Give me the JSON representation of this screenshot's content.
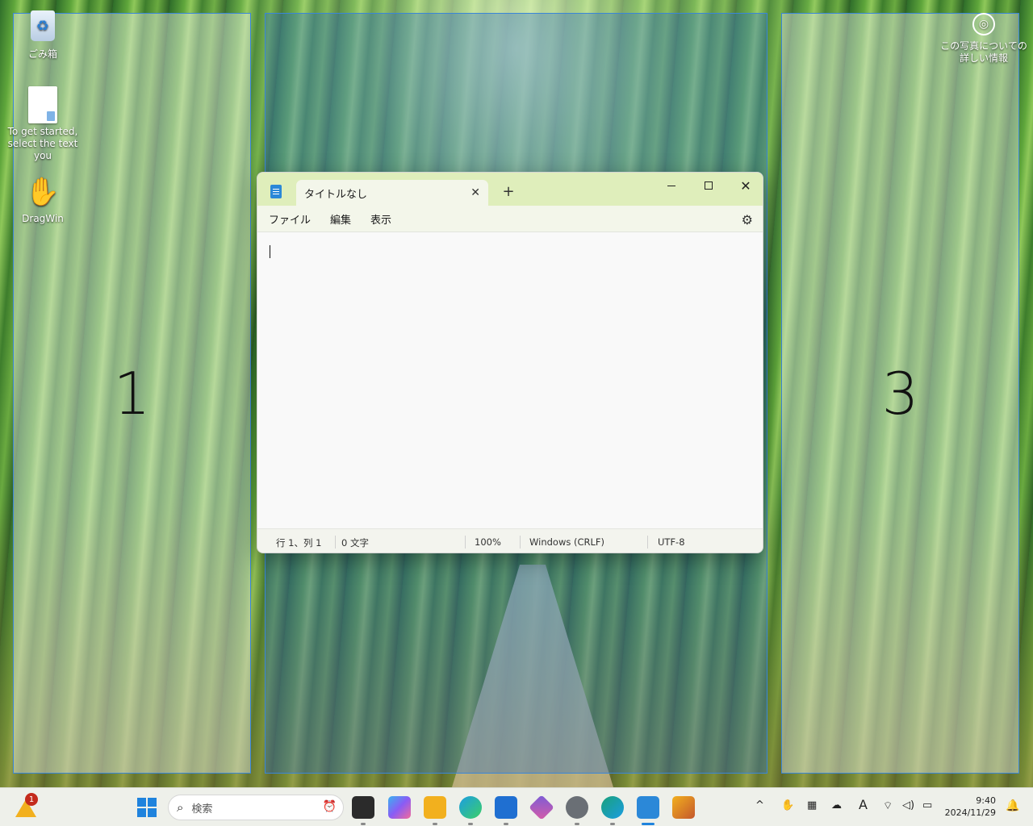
{
  "desktop": {
    "icons": [
      {
        "label": "ごみ箱",
        "icon": "recycle-bin-icon"
      },
      {
        "label": "To get started, select the text you",
        "icon": "document-icon"
      },
      {
        "label": "DragWin",
        "icon": "hand-icon"
      }
    ],
    "photo_info": "この写真についての詳しい情報",
    "zones": [
      {
        "number": "1"
      },
      {
        "number": ""
      },
      {
        "number": "3"
      }
    ]
  },
  "notepad": {
    "tab_title": "タイトルなし",
    "tab_close_glyph": "✕",
    "tab_add_glyph": "+",
    "menu": {
      "file": "ファイル",
      "edit": "編集",
      "view": "表示"
    },
    "status": {
      "position": "行 1、列 1",
      "chars": "0 文字",
      "zoom": "100%",
      "line_ending": "Windows (CRLF)",
      "encoding": "UTF-8"
    },
    "controls": {
      "close_glyph": "✕",
      "gear_glyph": "⚙"
    }
  },
  "taskbar": {
    "weather_badge": "1",
    "search_placeholder": "検索",
    "apps": [
      {
        "icon": "task-view-icon",
        "color": "#2b2b2b"
      },
      {
        "icon": "copilot-icon",
        "color": "#8a5cf5"
      },
      {
        "icon": "file-explorer-icon",
        "color": "#f2b01e"
      },
      {
        "icon": "edge-icon",
        "color": "#1b9de2"
      },
      {
        "icon": "store-icon",
        "color": "#1f6fd1"
      },
      {
        "icon": "photos-icon",
        "color": "#7c5cd6"
      },
      {
        "icon": "settings-icon",
        "color": "#6a6f75"
      },
      {
        "icon": "edge-dev-icon",
        "color": "#1aa17a"
      },
      {
        "icon": "notepad-icon",
        "color": "#2b88d8"
      },
      {
        "icon": "paint-icon",
        "color": "#c4572c"
      }
    ],
    "clock": {
      "time": "9:40",
      "date": "2024/11/29"
    },
    "tray": {
      "chevron": "^",
      "ime": "A"
    }
  }
}
